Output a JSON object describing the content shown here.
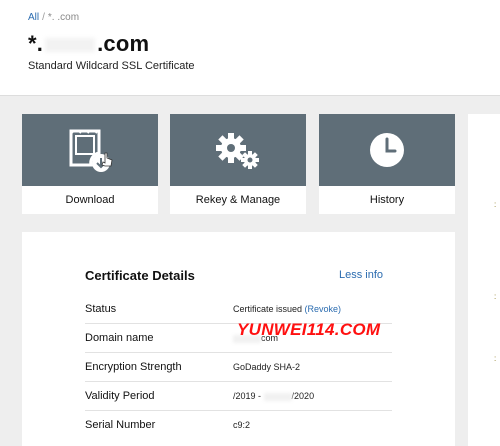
{
  "breadcrumb": {
    "root": "All",
    "separator": "/",
    "current": "*.     .com"
  },
  "domain": {
    "prefix": "*.",
    "suffix": ".com"
  },
  "subtitle": "Standard Wildcard SSL Certificate",
  "tiles": [
    {
      "label": "Download",
      "icon": "certificate-download-icon"
    },
    {
      "label": "Rekey & Manage",
      "icon": "gears-icon"
    },
    {
      "label": "History",
      "icon": "clock-icon"
    }
  ],
  "details": {
    "title": "Certificate Details",
    "less_info": "Less info",
    "rows": [
      {
        "label": "Status",
        "value": "Certificate issued",
        "link": "(Revoke)"
      },
      {
        "label": "Domain name",
        "value_suffix": "com"
      },
      {
        "label": "Encryption Strength",
        "value": "GoDaddy SHA-2"
      },
      {
        "label": "Validity Period",
        "value_start": "/2019 -",
        "value_end": "/2020"
      },
      {
        "label": "Serial Number",
        "value": "c9:2"
      }
    ]
  },
  "watermark": "YUNWEI114.COM",
  "colors": {
    "tile": "#5f6e78",
    "link": "#2b6cb0",
    "watermark": "#ff1010",
    "background": "#eeeeee"
  }
}
